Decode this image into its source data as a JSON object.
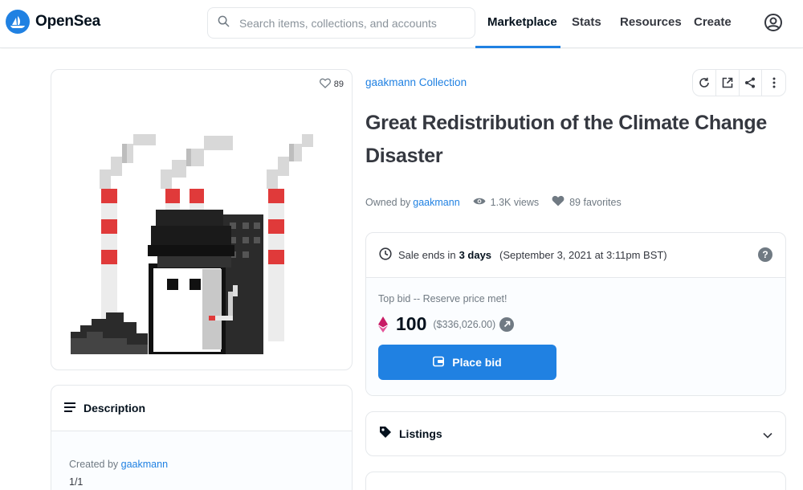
{
  "header": {
    "logo_text": "OpenSea",
    "search_placeholder": "Search items, collections, and accounts",
    "nav": [
      {
        "label": "Marketplace",
        "active": true
      },
      {
        "label": "Stats",
        "active": false
      },
      {
        "label": "Resources",
        "active": false
      },
      {
        "label": "Create",
        "active": false
      }
    ],
    "profile_icon": "account-circle-icon"
  },
  "asset": {
    "favorites_count": "89",
    "collection": "gaakmann Collection",
    "title": "Great Redistribution of the Climate Change Disaster",
    "owned_by_label": "Owned by",
    "owner": "gaakmann",
    "views": "1.3K views",
    "favorites": "89 favorites",
    "toolbar_icons": [
      "refresh-icon",
      "external-link-icon",
      "share-icon",
      "more-icon"
    ]
  },
  "sale": {
    "ends_prefix": "Sale ends in",
    "ends_value": "3 days",
    "ends_date": "(September 3, 2021 at 3:11pm BST)",
    "top_bid_label": "Top bid -- Reserve price met!",
    "price": "100",
    "price_usd": "($336,026.00)",
    "place_bid_label": "Place bid"
  },
  "listings": {
    "label": "Listings"
  },
  "description": {
    "label": "Description",
    "created_by_label": "Created by",
    "creator": "gaakmann",
    "edition": "1/1"
  },
  "colors": {
    "accent": "#2081e2",
    "text_primary": "#04111d",
    "text_secondary": "#707a83",
    "border": "#e5e8eb",
    "eth": "#c81c66"
  }
}
